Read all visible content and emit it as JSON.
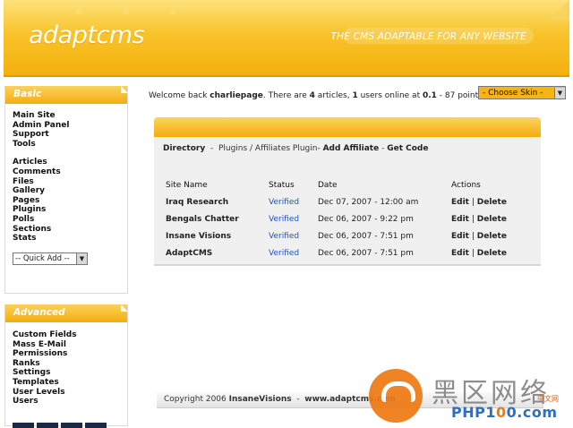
{
  "header": {
    "logo": "adaptcms",
    "tagline": "THE CMS ADAPTABLE FOR ANY WEBSITE"
  },
  "sidebar": {
    "basic": {
      "title": "Basic",
      "group1": [
        "Main Site",
        "Admin Panel",
        "Support",
        "Tools"
      ],
      "group2": [
        "Articles",
        "Comments",
        "Files",
        "Gallery",
        "Pages",
        "Plugins",
        "Polls",
        "Sections",
        "Stats"
      ],
      "quick_add": "-- Quick Add --"
    },
    "advanced": {
      "title": "Advanced",
      "items": [
        "Custom Fields",
        "Mass E-Mail",
        "Permissions",
        "Ranks",
        "Settings",
        "Templates",
        "User Levels",
        "Users"
      ]
    }
  },
  "welcome": {
    "prefix": "Welcome back ",
    "user": "charliepage",
    "t1": ". There are ",
    "articles": "4",
    "t2": " articles, ",
    "users": "1",
    "t3": " users online at ",
    "time": "0.1",
    "t4": " - 87 points"
  },
  "skin_select": "- Choose Skin -",
  "breadcrumb": {
    "root": "Directory",
    "sep1": "  -  ",
    "path": "Plugins / Affiliates Plugin",
    "sep2": "- ",
    "current": "Add Affiliate",
    "sep3": " - ",
    "action": "Get Code"
  },
  "table": {
    "headers": [
      "Site Name",
      "Status",
      "Date",
      "Actions"
    ],
    "rows": [
      {
        "name": "Iraq Research",
        "status": "Verified",
        "date": "Dec 07, 2007 - 12:00 am",
        "edit": "Edit",
        "sep": " | ",
        "delete": "Delete"
      },
      {
        "name": "Bengals Chatter",
        "status": "Verified",
        "date": "Dec 06, 2007 - 9:22 pm",
        "edit": "Edit",
        "sep": " | ",
        "delete": "Delete"
      },
      {
        "name": "Insane Visions",
        "status": "Verified",
        "date": "Dec 06, 2007 - 7:51 pm",
        "edit": "Edit",
        "sep": " | ",
        "delete": "Delete"
      },
      {
        "name": "AdaptCMS",
        "status": "Verified",
        "date": "Dec 06, 2007 - 7:51 pm",
        "edit": "Edit",
        "sep": " | ",
        "delete": "Delete"
      }
    ]
  },
  "footer": {
    "copy": "Copyright 2006 ",
    "company": "InsaneVisions",
    "sep": "  -  ",
    "site": "www.adaptcms.com"
  },
  "watermark": {
    "cn": "黑区网络",
    "en_a": "PHP1",
    "en_b": "0",
    "en_c": "0.com",
    "small": "中文网"
  },
  "colors": {
    "accent": "#f5b00e",
    "link_blue": "#2450c0"
  }
}
